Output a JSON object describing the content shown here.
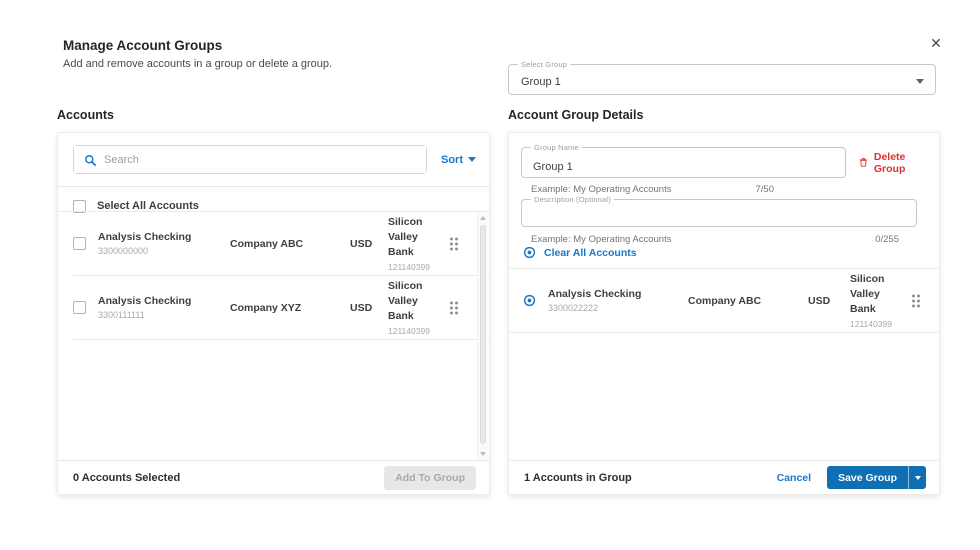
{
  "modal": {
    "title": "Manage Account Groups",
    "subtitle": "Add and remove accounts in a group or delete a group."
  },
  "icons": {
    "close": "✕",
    "search": "magnifier",
    "sort_caret": "▾",
    "select_caret": "▾",
    "save_caret": "▾",
    "delete": "trash-can",
    "remove_account": "circle-dot",
    "drag": "six-dot-handle"
  },
  "colors": {
    "link_blue": "#1877cb",
    "button_blue": "#0f6fb4",
    "danger_red": "#e02f2f",
    "text_dark": "#3d4043",
    "text_gray": "#a5a9ad",
    "border": "#e9e9e9"
  },
  "group_select": {
    "label": "Select Group",
    "value": "Group 1"
  },
  "accounts_panel": {
    "heading": "Accounts",
    "search_placeholder": "Search",
    "sort_label": "Sort",
    "select_all_label": "Select All Accounts",
    "rows": [
      {
        "name": "Analysis Checking",
        "number": "3300000000",
        "company": "Company ABC",
        "currency": "USD",
        "bank": "Silicon Valley Bank",
        "routing": "121140399"
      },
      {
        "name": "Analysis Checking",
        "number": "3300111111",
        "company": "Company XYZ",
        "currency": "USD",
        "bank": "Silicon Valley Bank",
        "routing": "121140399"
      }
    ],
    "footer": {
      "selected_text": "0 Accounts Selected",
      "add_button": "Add To Group"
    }
  },
  "group_panel": {
    "heading": "Account Group Details",
    "group_name": {
      "label": "Group Name",
      "value": "Group 1",
      "helper": "Example: My Operating Accounts",
      "counter": "7/50"
    },
    "delete_button": "Delete Group",
    "description": {
      "label": "Description (Optional)",
      "value": "",
      "helper": "Example: My Operating Accounts",
      "counter": "0/255"
    },
    "clear_all_label": "Clear All Accounts",
    "rows": [
      {
        "name": "Analysis Checking",
        "number": "3300022222",
        "company": "Company ABC",
        "currency": "USD",
        "bank": "Silicon Valley Bank",
        "routing": "121140399"
      }
    ],
    "footer": {
      "count_text": "1 Accounts in Group",
      "cancel_label": "Cancel",
      "save_label": "Save Group"
    }
  }
}
